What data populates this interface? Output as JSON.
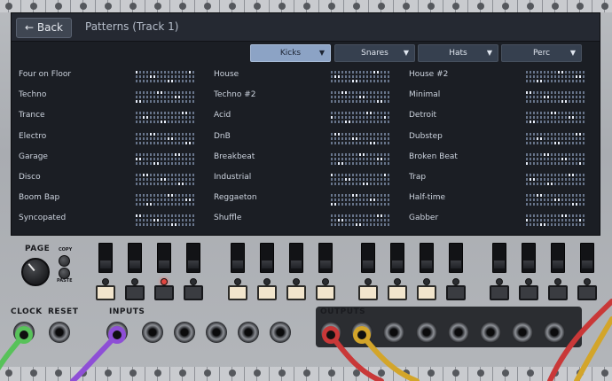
{
  "header": {
    "back_label": "← Back",
    "title": "Patterns (Track 1)"
  },
  "tabs": [
    {
      "label": "Kicks",
      "active": true
    },
    {
      "label": "Snares",
      "active": false
    },
    {
      "label": "Hats",
      "active": false
    },
    {
      "label": "Perc",
      "active": false
    }
  ],
  "patterns": [
    [
      "Four on Floor",
      "House",
      "House #2"
    ],
    [
      "Techno",
      "Techno #2",
      "Minimal"
    ],
    [
      "Trance",
      "Acid",
      "Detroit"
    ],
    [
      "Electro",
      "DnB",
      "Dubstep"
    ],
    [
      "Garage",
      "Breakbeat",
      "Broken Beat"
    ],
    [
      "Disco",
      "Industrial",
      "Trap"
    ],
    [
      "Boom Bap",
      "Reggaeton",
      "Half-time"
    ],
    [
      "Syncopated",
      "Shuffle",
      "Gabber"
    ]
  ],
  "hardware": {
    "page_label": "PAGE",
    "copy_label": "COPY",
    "paste_label": "PASTE",
    "clock_label": "CLOCK",
    "reset_label": "RESET",
    "inputs_label": "INPUTS",
    "outputs_label": "OUTPUTS",
    "step_states": [
      true,
      false,
      false,
      false,
      true,
      true,
      true,
      true,
      true,
      true,
      true,
      false,
      false,
      false,
      false,
      false
    ],
    "active_led": 2
  },
  "colors": {
    "accent_tab": "#8ca3c5",
    "cable_green": "#58c25a",
    "cable_purple": "#8e4fd6",
    "cable_red": "#c93838",
    "cable_yellow": "#d3a52a"
  }
}
